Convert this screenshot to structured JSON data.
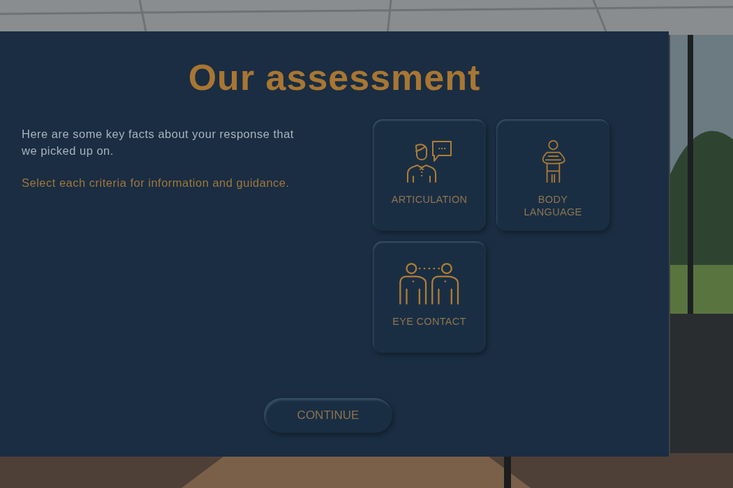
{
  "panel": {
    "title": "Our assessment",
    "intro": "Here are some key facts about your response that we picked up on.",
    "instruction": "Select each criteria for information and guidance."
  },
  "criteria": [
    {
      "kind": "articulation",
      "label": "ARTICULATION"
    },
    {
      "kind": "body",
      "label": "BODY LANGUAGE"
    },
    {
      "kind": "eye",
      "label": "EYE CONTACT"
    }
  ],
  "continue_button": {
    "label": "CONTINUE"
  }
}
